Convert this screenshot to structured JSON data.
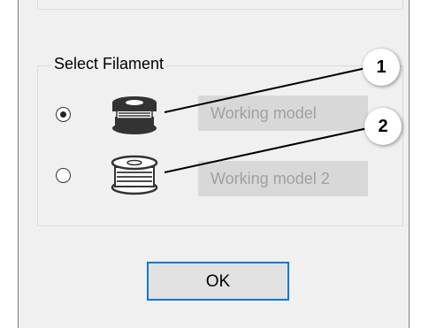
{
  "dialog": {
    "group_title": "Select Filament",
    "options": [
      {
        "label": "Working model",
        "selected": true,
        "icon": "filament-spool-filled-icon"
      },
      {
        "label": "Working model 2",
        "selected": false,
        "icon": "filament-spool-outline-icon"
      }
    ],
    "ok_label": "OK"
  },
  "callouts": [
    "1",
    "2"
  ],
  "colors": {
    "accent": "#0078d7",
    "dialog_bg": "#f0f0f0",
    "label_bg": "#d8d8d8"
  }
}
